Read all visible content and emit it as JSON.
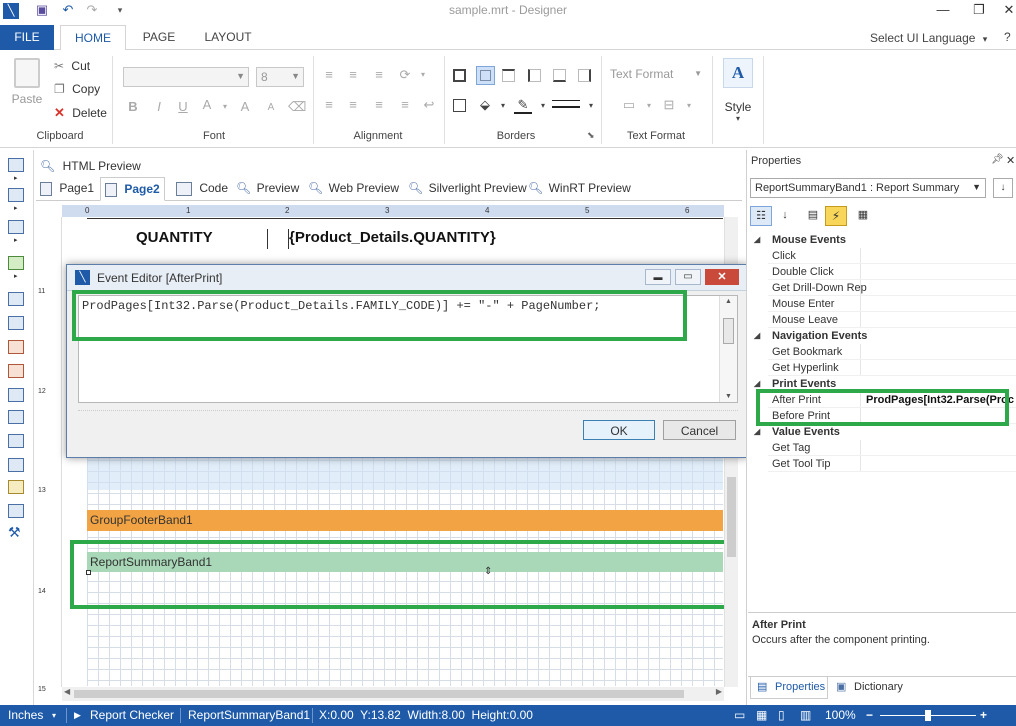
{
  "window": {
    "title": "sample.mrt - Designer",
    "controls": [
      "minimize-icon",
      "restore-icon",
      "close-icon"
    ]
  },
  "ribbon": {
    "tabs": [
      {
        "label": "FILE"
      },
      {
        "label": "HOME"
      },
      {
        "label": "PAGE"
      },
      {
        "label": "LAYOUT"
      }
    ],
    "ui_language": "Select UI Language",
    "help": "?",
    "clipboard": {
      "paste": "Paste",
      "cut": "Cut",
      "copy": "Copy",
      "delete": "Delete",
      "label": "Clipboard"
    },
    "font": {
      "size": "8",
      "label": "Font"
    },
    "alignment": {
      "label": "Alignment"
    },
    "borders": {
      "label": "Borders"
    },
    "text_format": {
      "combo": "Text Format",
      "label": "Text Format"
    },
    "style": {
      "label": "Style"
    }
  },
  "views": {
    "html_preview": "HTML Preview",
    "tabs": [
      "Page1",
      "Page2",
      "Code",
      "Preview",
      "Web Preview",
      "Silverlight Preview",
      "WinRT Preview"
    ],
    "active": "Page2"
  },
  "design": {
    "ruler_top": [
      "0",
      "1",
      "2",
      "3",
      "4",
      "5",
      "6"
    ],
    "ruler_left": [
      "11",
      "12",
      "13",
      "14",
      "15"
    ],
    "quantity_label": "QUANTITY",
    "quantity_expr": "{Product_Details.QUANTITY}",
    "group_footer": "GroupFooterBand1",
    "report_summary": "ReportSummaryBand1"
  },
  "dialog": {
    "title": "Event Editor [AfterPrint]",
    "code": "ProdPages[Int32.Parse(Product_Details.FAMILY_CODE)] += \"-\" + PageNumber;",
    "ok": "OK",
    "cancel": "Cancel"
  },
  "properties": {
    "header": "Properties",
    "selected_component": "ReportSummaryBand1 : Report Summary",
    "rows": [
      {
        "name": "Mouse  Events",
        "category": true
      },
      {
        "name": "Click",
        "value": ""
      },
      {
        "name": "Double Click",
        "value": ""
      },
      {
        "name": "Get Drill-Down Rep",
        "value": ""
      },
      {
        "name": "Mouse Enter",
        "value": ""
      },
      {
        "name": "Mouse Leave",
        "value": ""
      },
      {
        "name": "Navigation  Events",
        "category": true
      },
      {
        "name": "Get Bookmark",
        "value": ""
      },
      {
        "name": "Get Hyperlink",
        "value": ""
      },
      {
        "name": "Print  Events",
        "category": true
      },
      {
        "name": "After Print",
        "value": "ProdPages[Int32.Parse(Proc"
      },
      {
        "name": "Before Print",
        "value": ""
      },
      {
        "name": "Value  Events",
        "category": true
      },
      {
        "name": "Get Tag",
        "value": ""
      },
      {
        "name": "Get Tool Tip",
        "value": ""
      }
    ],
    "description_title": "After Print",
    "description_text": "Occurs after the component printing.",
    "bottom_tabs": [
      "Properties",
      "Dictionary"
    ]
  },
  "status": {
    "units": "Inches",
    "report_checker": "Report Checker",
    "component": "ReportSummaryBand1",
    "position": "X:0.00  Y:13.82  Width:8.00  Height:0.00",
    "zoom": "100%"
  },
  "colors": {
    "accent": "#1e5aa8",
    "group_footer": "#f2a444",
    "report_summary": "#a8d8b8",
    "highlight": "#2ea94a"
  }
}
